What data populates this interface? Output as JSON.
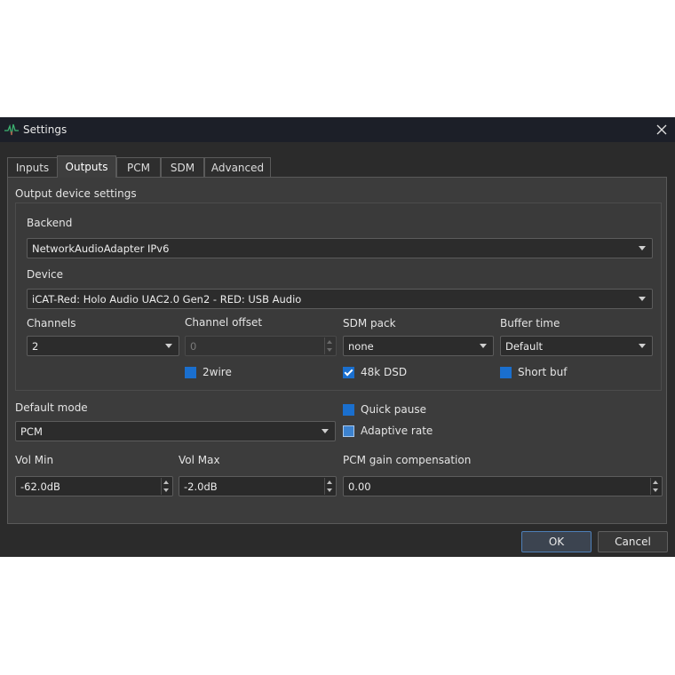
{
  "window": {
    "title": "Settings",
    "close_icon": "close-icon",
    "app_icon": "waveform-icon"
  },
  "tabs": [
    "Inputs",
    "Outputs",
    "PCM",
    "SDM",
    "Advanced"
  ],
  "active_tab": "Outputs",
  "output_group": {
    "title": "Output device settings",
    "backend": {
      "label": "Backend",
      "value": "NetworkAudioAdapter IPv6"
    },
    "device": {
      "label": "Device",
      "value": "iCAT-Red: Holo Audio UAC2.0 Gen2 - RED: USB Audio"
    },
    "channels": {
      "label": "Channels",
      "value": "2"
    },
    "channel_offset": {
      "label": "Channel offset",
      "value": "0"
    },
    "sdm_pack": {
      "label": "SDM pack",
      "value": "none"
    },
    "buffer_time": {
      "label": "Buffer time",
      "value": "Default"
    },
    "two_wire": {
      "label": "2wire",
      "checked": false
    },
    "dsd48k": {
      "label": "48k DSD",
      "checked": true
    },
    "short_buf": {
      "label": "Short buf",
      "checked": false
    }
  },
  "default_mode": {
    "label": "Default mode",
    "value": "PCM"
  },
  "quick_pause": {
    "label": "Quick pause",
    "checked": false
  },
  "adaptive_rate": {
    "label": "Adaptive rate",
    "checked": false
  },
  "vol_min": {
    "label": "Vol Min",
    "value": "-62.0dB"
  },
  "vol_max": {
    "label": "Vol Max",
    "value": "-2.0dB"
  },
  "pcm_gain": {
    "label": "PCM gain compensation",
    "value": "0.00"
  },
  "buttons": {
    "ok": "OK",
    "cancel": "Cancel"
  },
  "colors": {
    "accent": "#1a6fce",
    "titlebar": "#1c1f28",
    "panel": "#3c3c3c"
  }
}
